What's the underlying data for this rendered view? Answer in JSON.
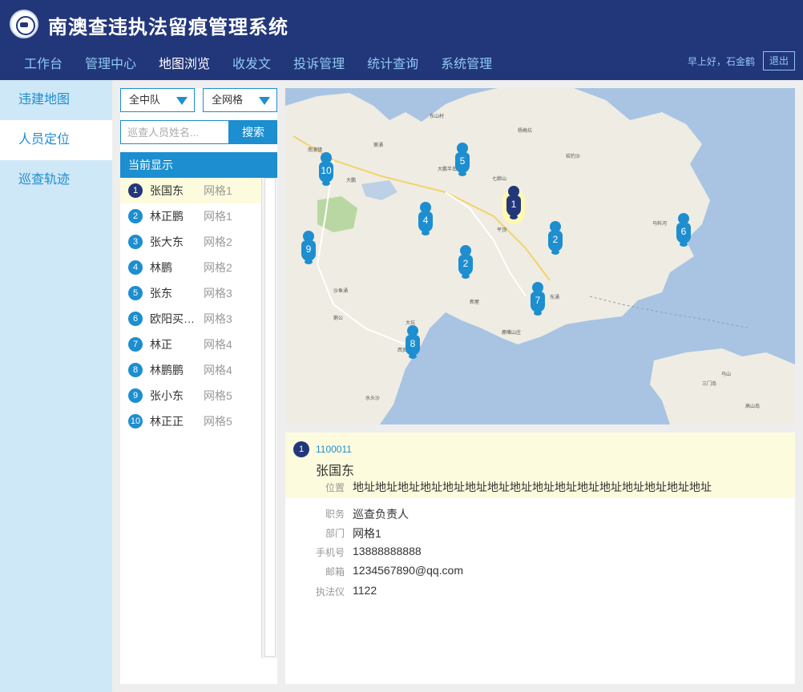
{
  "header": {
    "title": "南澳查违执法留痕管理系统",
    "logo_icon": "emblem-icon",
    "greeting": "早上好，石金鹤",
    "logout_label": "退出",
    "nav": [
      {
        "label": "工作台"
      },
      {
        "label": "管理中心"
      },
      {
        "label": "地图浏览",
        "active": true
      },
      {
        "label": "收发文"
      },
      {
        "label": "投诉管理"
      },
      {
        "label": "统计查询"
      },
      {
        "label": "系统管理"
      }
    ]
  },
  "sidebar": {
    "items": [
      {
        "label": "违建地图"
      },
      {
        "label": "人员定位",
        "active": true
      },
      {
        "label": "巡查轨迹"
      }
    ]
  },
  "filters": {
    "team": "全中队",
    "grid": "全网格",
    "search_placeholder": "巡查人员姓名...",
    "search_label": "搜索"
  },
  "list": {
    "header": "当前显示",
    "rows": [
      {
        "num": "1",
        "name": "张国东",
        "grid": "网格1",
        "selected": true
      },
      {
        "num": "2",
        "name": "林正鹏",
        "grid": "网格1"
      },
      {
        "num": "3",
        "name": "张大东",
        "grid": "网格2"
      },
      {
        "num": "4",
        "name": "林鹏",
        "grid": "网格2"
      },
      {
        "num": "5",
        "name": "张东",
        "grid": "网格3"
      },
      {
        "num": "6",
        "name": "欧阳买买...",
        "grid": "网格3"
      },
      {
        "num": "7",
        "name": "林正",
        "grid": "网格4"
      },
      {
        "num": "8",
        "name": "林鹏鹏",
        "grid": "网格4"
      },
      {
        "num": "9",
        "name": "张小东",
        "grid": "网格5"
      },
      {
        "num": "10",
        "name": "林正正",
        "grid": "网格5"
      }
    ]
  },
  "map": {
    "pins": [
      {
        "label": "1",
        "selected": true
      },
      {
        "label": "2"
      },
      {
        "label": "2"
      },
      {
        "label": "4"
      },
      {
        "label": "5"
      },
      {
        "label": "6"
      },
      {
        "label": "7"
      },
      {
        "label": "8"
      },
      {
        "label": "9"
      },
      {
        "label": "10"
      }
    ],
    "place_labels": [
      "南澳镇",
      "葵涌",
      "大鹏半岛",
      "七娘山",
      "平顶",
      "马料河",
      "东涌",
      "桔钓沙",
      "杨梅坑",
      "新屋",
      "东山村",
      "鹿嘴山庄",
      "西贡",
      "沙鱼涌",
      "大鹏",
      "水头沙",
      "鹅公",
      "马山",
      "三门岛",
      "大坑",
      "高山岛"
    ]
  },
  "detail": {
    "num": "1",
    "id": "1100011",
    "name": "张国东",
    "fields": [
      {
        "label": "位置",
        "value": "地址地址地址地址地址地址地址地址地址地址地址地址地址地址地址地址"
      },
      {
        "label": "职务",
        "value": "巡查负责人"
      },
      {
        "label": "部门",
        "value": "网格1"
      },
      {
        "label": "手机号",
        "value": "13888888888"
      },
      {
        "label": "邮箱",
        "value": "1234567890@qq.com"
      },
      {
        "label": "执法仪",
        "value": "1122"
      }
    ]
  }
}
